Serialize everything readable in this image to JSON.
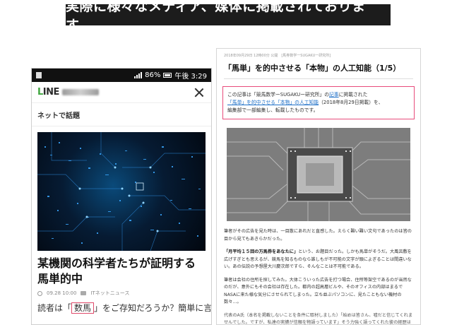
{
  "banner": {
    "text": "実際に様々なメディア、媒体に掲載されております。"
  },
  "phone": {
    "status": {
      "battery": "86%",
      "time": "午後 3:29"
    },
    "section_title": "ネットで話題",
    "article": {
      "title_line1": "某機関の科学者たちが証明する",
      "title_line2": "馬単的中",
      "meta_time": "09.28 10:00",
      "meta_source": "ITネットニュース",
      "lead_before": "読者は「",
      "lead_highlight": "数馬",
      "lead_after": "」をご存知だろうか？簡単に言うと、"
    },
    "icons": [
      "logo-icon",
      "close-icon",
      "clock-icon",
      "camera-icon",
      "signal-icon",
      "battery-icon"
    ]
  },
  "web": {
    "date": "2018年09月29日 12時00分 公開　[馬券数学一SUGAKU一研究所]",
    "title": "「馬単」を的中させる「本物」の人工知能（1/5）",
    "notice": {
      "l1_a": "この記事は「競馬数学ーSUGAKUー研究所」の",
      "l1_link": "記事",
      "l1_b": "に掲載された",
      "l2_link": "「馬単」を的中させる「本物」の人工知能",
      "l2_b": "（2018年8月29日掲載）を、",
      "l3": "編集部で一部編集し、転載したものです。"
    },
    "body": {
      "p1": "筆者がその広告を見た時は、一目散にあれだと直感した。えらく難い難い文句であったのは皆の目から見てもあきらかだった。",
      "p2_bold": "「月平均１５回の万馬券をあなたに」",
      "p2_rest": "という、お題目だった。しかも馬単がそうだ。大風呂敷を広げすぎとも思えるが、競馬を知るものなら誰しもが不可能の文字が頭によぎることは間違いない。あの伝説の予想屋大川慶次郎ですら、そんなことは不可能である。",
      "p3": "筆者は会社の住所を探してみた。大体こういった広告を打つ場合、住所等架空であるのが当然なのだが、意外にもその会社は存在した。都内の超高層ビルや、そのオフィスの内部はまるでNASAに来た様な気分にさせられてしまった。立ち並ぶパソコンに、見たこともない機材の数々…。",
      "p4": "代表のA氏（本名を掲載しないことを条件に取材しました）「始めは皆さん、嘘だと信じてくれませんでした。ですが、私達の実績が信頼を物語っています」そう力強く語ってくれた彼の経歴は我々ながらトップシークレットらしいので、聞き出せはしなかったが、その万馬"
    }
  }
}
